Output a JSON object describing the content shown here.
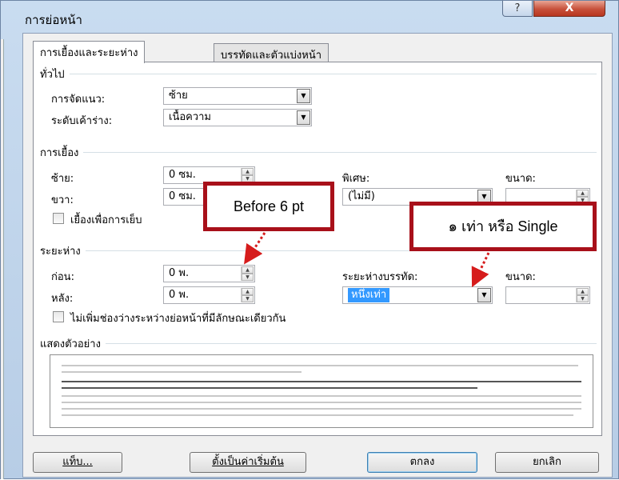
{
  "window": {
    "title": "การย่อหน้า",
    "help_button": "?",
    "close_button": "X"
  },
  "tabs": [
    {
      "label": "การเยื้องและระยะห่าง",
      "active": true
    },
    {
      "label": "บรรทัดและตัวแบ่งหน้า",
      "active": false
    }
  ],
  "general": {
    "heading": "ทั่วไป",
    "alignment_label": "การจัดแนว:",
    "alignment_value": "ซ้าย",
    "outline_label": "ระดับเค้าร่าง:",
    "outline_value": "เนื้อความ"
  },
  "indentation": {
    "heading": "การเยื้อง",
    "left_label": "ซ้าย:",
    "left_value": "0 ซม.",
    "right_label": "ขวา:",
    "right_value": "0 ซม.",
    "special_label": "พิเศษ:",
    "special_value": "(ไม่มี)",
    "by_label": "ขนาด:",
    "by_value": "",
    "mirror_label": "เยื้องเพื่อการเย็บ"
  },
  "spacing": {
    "heading": "ระยะห่าง",
    "before_label": "ก่อน:",
    "before_value": "0 พ.",
    "after_label": "หลัง:",
    "after_value": "0 พ.",
    "line_spacing_label": "ระยะห่างบรรทัด:",
    "line_spacing_value": "หนึ่งเท่า",
    "at_label": "ขนาด:",
    "at_value": "",
    "no_space_label": "ไม่เพิ่มช่องว่างระหว่างย่อหน้าที่มีลักษณะเดียวกัน"
  },
  "preview": {
    "heading": "แสดงตัวอย่าง"
  },
  "buttons": {
    "tabs": "แท็บ...",
    "set_default": "ตั้งเป็นค่าเริ่มต้น",
    "ok": "ตกลง",
    "cancel": "ยกเลิก"
  },
  "annotations": {
    "before_callout": "Before 6 pt",
    "line_callout": "๑ เท่า หรือ Single",
    "callout_color": "#a8101a"
  }
}
